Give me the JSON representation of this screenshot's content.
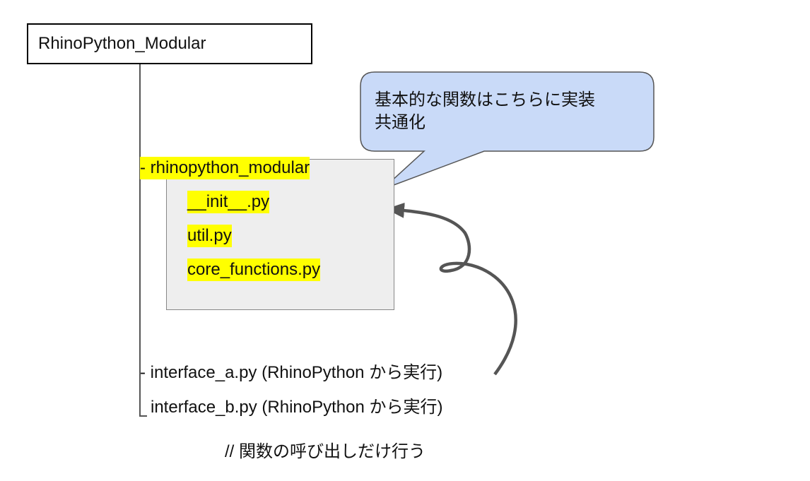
{
  "root": {
    "label": "RhinoPython_Modular"
  },
  "package": {
    "label": "rhinopython_modular",
    "files": [
      "__init__.py",
      "util.py",
      "core_functions.py"
    ]
  },
  "interfaces": [
    {
      "label": "interface_a.py (RhinoPython から実行)"
    },
    {
      "label": "interface_b.py (RhinoPython から実行)"
    }
  ],
  "callout": {
    "line1": "基本的な関数はこちらに実装",
    "line2": "共通化",
    "fill": "#c9daf8",
    "stroke": "#555555"
  },
  "comment": "// 関数の呼び出しだけ行う",
  "colors": {
    "highlight": "#ffff00",
    "package_fill": "#eeeeee",
    "tree_line": "#555555"
  }
}
